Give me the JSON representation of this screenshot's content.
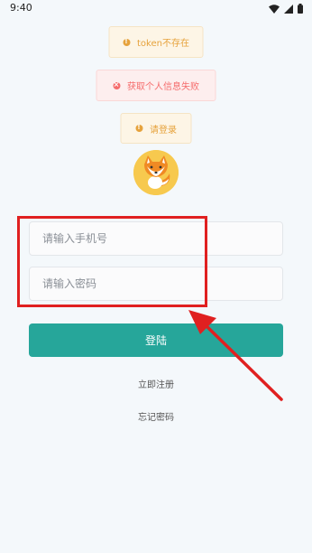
{
  "status_bar": {
    "time": "9:40"
  },
  "toasts": {
    "token": "token不存在",
    "userinfo": "获取个人信息失败",
    "login": "请登录"
  },
  "form": {
    "phone_placeholder": "请输入手机号",
    "password_placeholder": "请输入密码",
    "login_label": "登陆",
    "register_label": "立即注册",
    "forgot_label": "忘记密码"
  },
  "colors": {
    "primary": "#26a69a",
    "warning": "#e6a23c",
    "error": "#f56c6c",
    "annotation": "#e02020"
  }
}
